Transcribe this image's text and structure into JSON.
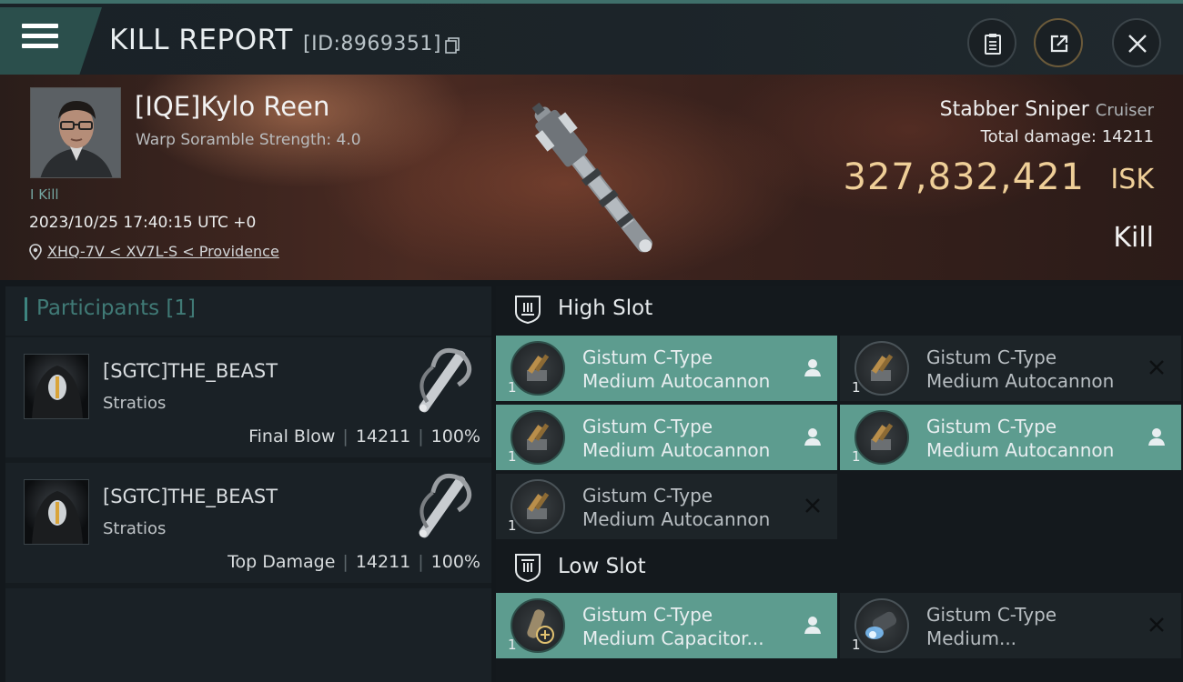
{
  "header": {
    "title": "KILL REPORT",
    "report_id": "[ID:8969351]",
    "buttons": [
      "clipboard-icon",
      "share-icon",
      "close-icon"
    ]
  },
  "victim": {
    "name": "[IQE]Kylo Reen",
    "subtitle": "Warp Soramble Strength: 4.0",
    "kill_tag": "I Kill",
    "timestamp": "2023/10/25 17:40:15 UTC +0",
    "location": "XHQ-7V < XV7L-S < Providence",
    "ship_name": "Stabber Sniper",
    "ship_class": "Cruiser",
    "total_damage_label": "Total damage:",
    "total_damage": "14211",
    "isk_value": "327,832,421",
    "isk_unit": "ISK",
    "outcome": "Kill"
  },
  "participants": {
    "label": "Participants",
    "count": "[1]",
    "rows": [
      {
        "name": "[SGTC]THE_BEAST",
        "ship": "Stratios",
        "role": "Final Blow",
        "damage": "14211",
        "percent": "100%"
      },
      {
        "name": "[SGTC]THE_BEAST",
        "ship": "Stratios",
        "role": "Top Damage",
        "damage": "14211",
        "percent": "100%"
      }
    ]
  },
  "fitting": {
    "high_slot": {
      "title": "High Slot",
      "modules": [
        {
          "line1": "Gistum C-Type",
          "line2": "Medium Autocannon",
          "qty": "1",
          "state": "on",
          "status_icon": "pilot-icon"
        },
        {
          "line1": "Gistum C-Type",
          "line2": "Medium Autocannon",
          "qty": "1",
          "state": "off",
          "status_icon": "destroyed-x-icon"
        },
        {
          "line1": "Gistum C-Type",
          "line2": "Medium Autocannon",
          "qty": "1",
          "state": "on",
          "status_icon": "pilot-icon"
        },
        {
          "line1": "Gistum C-Type",
          "line2": "Medium Autocannon",
          "qty": "1",
          "state": "on",
          "status_icon": "pilot-icon"
        },
        {
          "line1": "Gistum C-Type",
          "line2": "Medium Autocannon",
          "qty": "1",
          "state": "off",
          "status_icon": "destroyed-x-icon"
        }
      ]
    },
    "low_slot": {
      "title": "Low Slot",
      "modules": [
        {
          "line1": "Gistum C-Type",
          "line2": "Medium Capacitor...",
          "qty": "1",
          "state": "on",
          "status_icon": "pilot-icon"
        },
        {
          "line1": "Gistum C-Type",
          "line2": "Medium...",
          "qty": "1",
          "state": "off",
          "status_icon": "destroyed-x-icon"
        }
      ]
    }
  },
  "colors": {
    "accent_teal": "#5d9c8f",
    "isk_gold": "#efcf98",
    "participants_teal": "#407a76"
  }
}
